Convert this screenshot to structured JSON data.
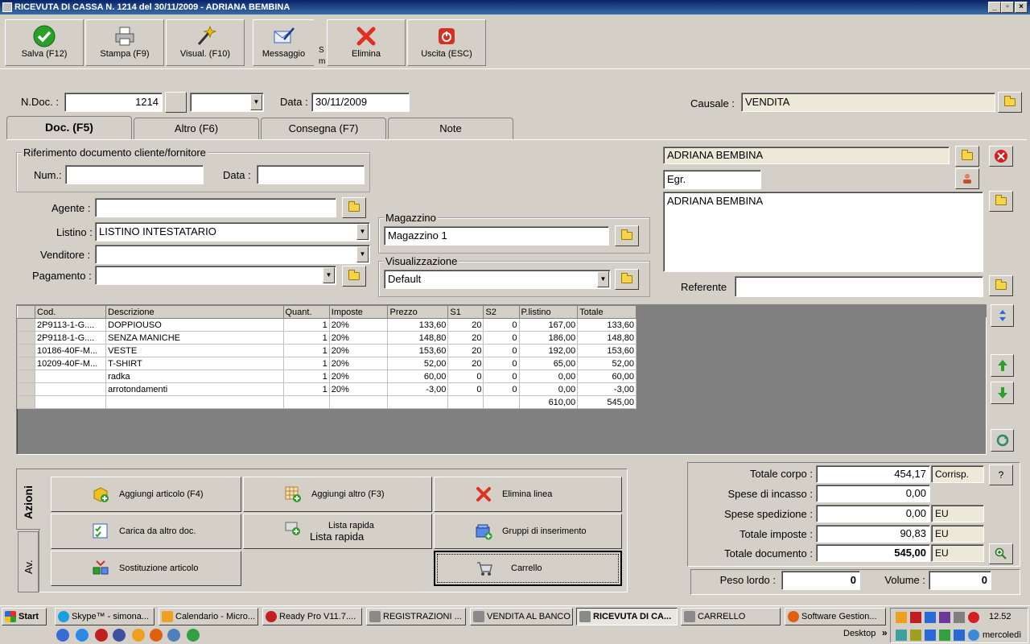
{
  "window": {
    "title": "RICEVUTA DI CASSA N. 1214  del 30/11/2009 - ADRIANA BEMBINA",
    "controls": [
      "_",
      "▫",
      "×"
    ]
  },
  "toolbar": {
    "save": "Salva (F12)",
    "print": "Stampa (F9)",
    "view": "Visual. (F10)",
    "message": "Messaggio",
    "message_fragment": "S\nm",
    "delete": "Elimina",
    "exit": "Uscita (ESC)"
  },
  "header": {
    "ndoc_label": "N.Doc. :",
    "ndoc_value": "1214",
    "date_label": "Data :",
    "date_value": "30/11/2009",
    "causale_label": "Causale :",
    "causale_value": "VENDITA"
  },
  "tabs": [
    "Doc. (F5)",
    "Altro (F6)",
    "Consegna (F7)",
    "Note"
  ],
  "ref_group": {
    "title": "Riferimento documento cliente/fornitore",
    "num_label": "Num.:",
    "data_label": "Data :"
  },
  "left_fields": {
    "agente_label": "Agente :",
    "listino_label": "Listino :",
    "listino_value": "LISTINO INTESTATARIO",
    "venditore_label": "Venditore :",
    "pagamento_label": "Pagamento :"
  },
  "magazzino": {
    "title": "Magazzino",
    "value": "Magazzino 1"
  },
  "visualizzazione": {
    "title": "Visualizzazione",
    "value": "Default"
  },
  "customer": {
    "name": "ADRIANA BEMBINA",
    "salutation": "Egr.",
    "address": "ADRIANA BEMBINA",
    "referente_label": "Referente"
  },
  "grid": {
    "headers": [
      "Cod.",
      "Descrizione",
      "Quant.",
      "Imposte",
      "Prezzo",
      "S1",
      "S2",
      "P.listino",
      "Totale"
    ],
    "rows": [
      [
        "2P9113-1-G....",
        "DOPPIOUSO",
        "1",
        "20%",
        "133,60",
        "20",
        "0",
        "167,00",
        "133,60"
      ],
      [
        "2P9118-1-G....",
        "SENZA MANICHE",
        "1",
        "20%",
        "148,80",
        "20",
        "0",
        "186,00",
        "148,80"
      ],
      [
        "10186-40F-M...",
        "VESTE",
        "1",
        "20%",
        "153,60",
        "20",
        "0",
        "192,00",
        "153,60"
      ],
      [
        "10209-40F-M...",
        "T-SHIRT",
        "1",
        "20%",
        "52,00",
        "20",
        "0",
        "65,00",
        "52,00"
      ],
      [
        "",
        "radka",
        "1",
        "20%",
        "60,00",
        "0",
        "0",
        "0,00",
        "60,00"
      ],
      [
        "",
        "arrotondamenti",
        "1",
        "20%",
        "-3,00",
        "0",
        "0",
        "0,00",
        "-3,00"
      ]
    ],
    "footer": [
      "",
      "",
      "",
      "",
      "",
      "",
      "",
      "610,00",
      "545,00"
    ]
  },
  "side_tabs": {
    "azioni": "Azioni",
    "av": "Av."
  },
  "actions": {
    "add_article": "Aggiungi articolo (F4)",
    "add_other": "Aggiungi altro (F3)",
    "delete_line": "Elimina linea",
    "load_other": "Carica da altro doc.",
    "quick_list_title": "Lista rapida",
    "quick_list_sub": "Lista rapida",
    "insert_groups": "Gruppi di inserimento",
    "replace_article": "Sostituzione articolo",
    "cart": "Carrello"
  },
  "totals": {
    "corpo_label": "Totale corpo :",
    "corpo_value": "454,17",
    "corpo_unit": "Corrisp.",
    "help": "?",
    "incasso_label": "Spese di incasso :",
    "incasso_value": "0,00",
    "spedizione_label": "Spese spedizione :",
    "spedizione_value": "0,00",
    "spedizione_unit": "EU",
    "imposte_label": "Totale imposte :",
    "imposte_value": "90,83",
    "imposte_unit": "EU",
    "documento_label": "Totale documento :",
    "documento_value": "545,00",
    "documento_unit": "EU",
    "peso_label": "Peso lordo :",
    "peso_value": "0",
    "volume_label": "Volume :",
    "volume_value": "0"
  },
  "taskbar": {
    "start": "Start",
    "tasks": [
      "Skype™ - simona...",
      "Calendario - Micro...",
      "Ready Pro V11.7....",
      "REGISTRAZIONI ...",
      "VENDITA AL BANCO",
      "RICEVUTA DI CA...",
      "CARRELLO",
      "Software Gestion..."
    ],
    "desktop": "Desktop",
    "chevron": "»",
    "time": "12.52",
    "day": "mercoledì"
  }
}
